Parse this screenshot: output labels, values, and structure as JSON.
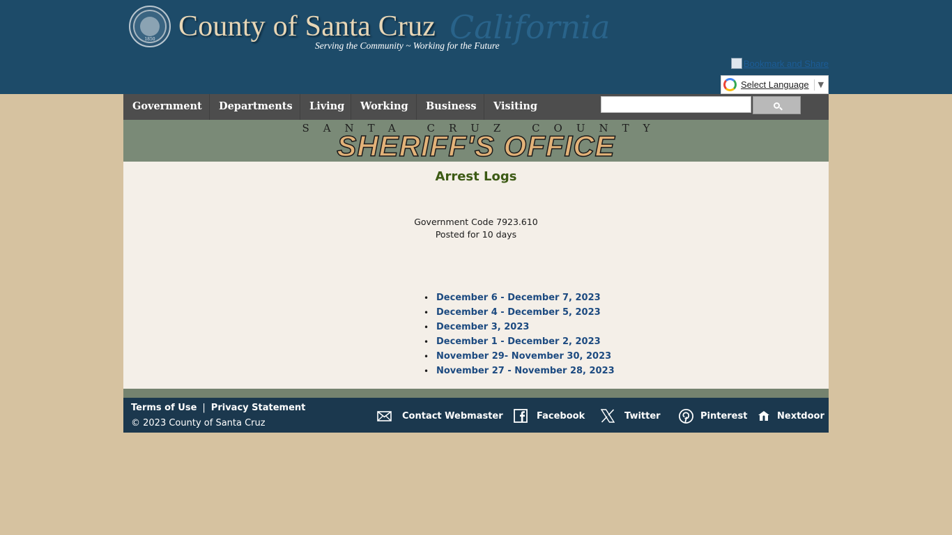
{
  "header": {
    "title": "County of Santa Cruz",
    "california": "California",
    "tagline": "Serving the Community ~ Working for the Future",
    "seal_year": "1850",
    "bookmark_label": "Bookmark and Share",
    "translate_label": "Select Language",
    "translate_arrow": "▼"
  },
  "nav": {
    "items": [
      {
        "label": "Government"
      },
      {
        "label": "Departments"
      },
      {
        "label": "Living"
      },
      {
        "label": "Working"
      },
      {
        "label": "Business"
      },
      {
        "label": "Visiting"
      }
    ],
    "search_placeholder": ""
  },
  "banner": {
    "county": "SANTA CRUZ COUNTY",
    "office": "SHERIFF'S OFFICE"
  },
  "main": {
    "title": "Arrest Logs",
    "gov_code": "Government Code 7923.610",
    "posted": "Posted for 10 days",
    "logs": [
      {
        "bullet": "•",
        "label": "December 6 - December 7, 2023"
      },
      {
        "bullet": "•",
        "label": "December 4 - December 5, 2023"
      },
      {
        "bullet": "•",
        "label": "December 3, 2023"
      },
      {
        "bullet": "•",
        "label": "December 1 - December 2, 2023"
      },
      {
        "bullet": "•",
        "label": "November 29- November 30, 2023"
      },
      {
        "bullet": "•",
        "label": "November 27 - November 28, 2023"
      }
    ]
  },
  "footer": {
    "terms": "Terms of Use",
    "separator": "|",
    "privacy": "Privacy Statement",
    "copyright": "© 2023 County of Santa Cruz",
    "social": [
      {
        "icon": "mail-icon",
        "label": "Contact Webmaster"
      },
      {
        "icon": "facebook-icon",
        "label": "Facebook"
      },
      {
        "icon": "twitter-x-icon",
        "label": "Twitter"
      },
      {
        "icon": "pinterest-icon",
        "label": "Pinterest"
      },
      {
        "icon": "nextdoor-icon",
        "label": "Nextdoor"
      }
    ]
  },
  "colors": {
    "header_bg": "#1d4b69",
    "nav_bg": "#4d4d4d",
    "banner_bg": "#7a8a77",
    "main_bg": "#f4efe8",
    "footer_bg": "#1b384e",
    "page_bg": "#d6c2a0",
    "title_green": "#3c5a14",
    "link_blue": "#1c4a80"
  }
}
